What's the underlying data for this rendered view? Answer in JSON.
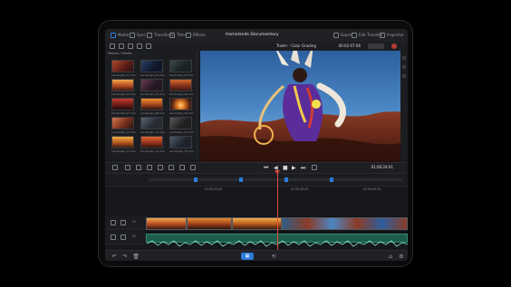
{
  "app": {
    "project_title": "Homelands Documentary",
    "colors": {
      "accent_blue": "#2d7bdc",
      "playhead_red": "#e44a3d",
      "audio_green": "#2f8c73",
      "panel_bg": "#1c1d20"
    }
  },
  "topbar": {
    "tabs": [
      {
        "label": "Media"
      },
      {
        "label": "Sync"
      },
      {
        "label": "Transitions"
      },
      {
        "label": "Titles"
      },
      {
        "label": "Effects"
      }
    ],
    "right": [
      {
        "label": "Export"
      },
      {
        "label": "Edit Timeline"
      },
      {
        "label": "Inspector"
      }
    ]
  },
  "media": {
    "header": "Master / Media",
    "thumb_labels": [
      "Landscape_01.mov",
      "Landscape_02.mov",
      "Landscape_03.mov",
      "Landscape_04.mov",
      "Landscape_05.mov",
      "Landscape_06.mov",
      "Landscape_07.mov",
      "Landscape_08.mov",
      "Landscape_09.mov",
      "Landscape_10.mov",
      "Landscape_11.mov",
      "Landscape_12.mov",
      "Landscape_13.mov",
      "Landscape_14.mov",
      "Landscape_15.mov"
    ]
  },
  "viewer": {
    "title": "Trailer - Color Grading",
    "timecode_top": "00:02:07:06",
    "timecode_bottom": "01:00:24:01"
  },
  "timeline": {
    "ruler_labels": [
      "01:00:15:00",
      "01:00:30:00",
      "01:00:45:00"
    ],
    "track_labels": {
      "v1": "V1",
      "a1": "A1"
    }
  }
}
